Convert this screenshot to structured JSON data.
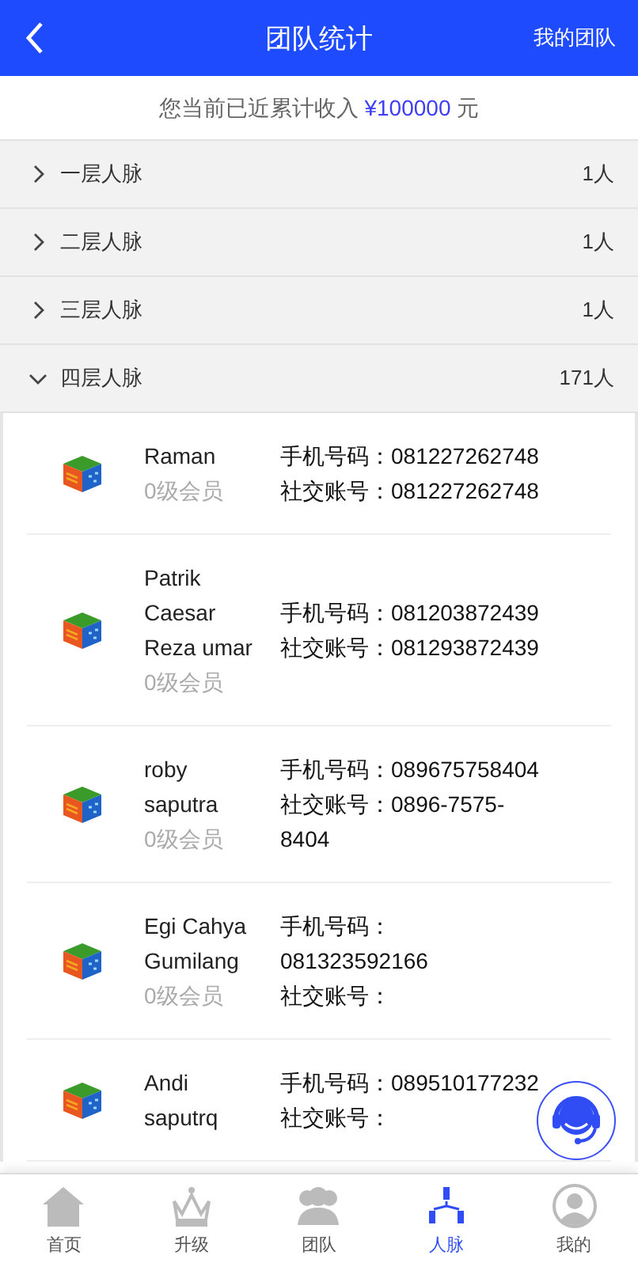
{
  "header": {
    "title": "团队统计",
    "action": "我的团队"
  },
  "summary": {
    "prefix": "您当前已近累计收入",
    "amount": "¥100000",
    "suffix": "元"
  },
  "levels": [
    {
      "label": "一层人脉",
      "count": "1人",
      "expanded": false
    },
    {
      "label": "二层人脉",
      "count": "1人",
      "expanded": false
    },
    {
      "label": "三层人脉",
      "count": "1人",
      "expanded": false
    },
    {
      "label": "四层人脉",
      "count": "171人",
      "expanded": true
    }
  ],
  "members": [
    {
      "name": "Raman",
      "level": "0级会员",
      "phone": "手机号码：081227262748",
      "social": "社交账号：081227262748"
    },
    {
      "name": "Patrik Caesar Reza umar",
      "level": "0级会员",
      "phone": "手机号码：081203872439",
      "social": "社交账号：081293872439"
    },
    {
      "name": "roby saputra",
      "level": "0级会员",
      "phone": "手机号码：089675758404",
      "social": "社交账号：0896-7575-8404"
    },
    {
      "name": "Egi Cahya Gumilang",
      "level": "0级会员",
      "phone": "手机号码：081323592166",
      "social": "社交账号："
    },
    {
      "name": "Andi saputrq",
      "phone": "手机号码：089510177232",
      "social": "社交账号："
    }
  ],
  "tabs": [
    {
      "label": "首页",
      "kind": "home",
      "selected": false
    },
    {
      "label": "升级",
      "kind": "crown",
      "selected": false
    },
    {
      "label": "团队",
      "kind": "team",
      "selected": false
    },
    {
      "label": "人脉",
      "kind": "network",
      "selected": true
    },
    {
      "label": "我的",
      "kind": "user",
      "selected": false
    }
  ]
}
